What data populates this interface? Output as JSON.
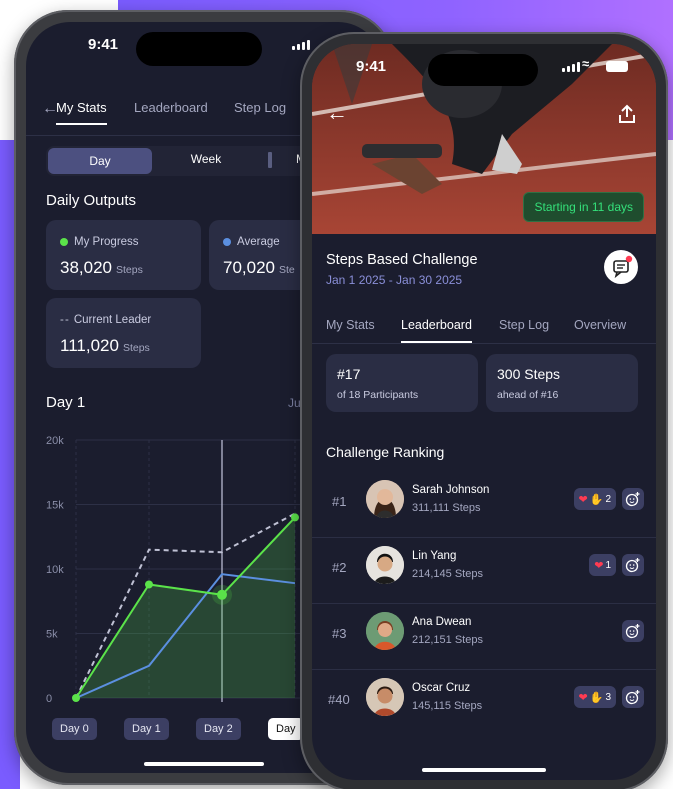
{
  "colors": {
    "accent_green": "#5be34a",
    "accent_blue": "#5b8fe0",
    "leader_grey": "#bfc1d4",
    "bg_dark": "#1b1d2e",
    "card": "#2a2d44"
  },
  "phone1": {
    "status_time": "9:41",
    "tabs": [
      "My Stats",
      "Leaderboard",
      "Step Log"
    ],
    "segments": [
      "Day",
      "Week",
      "M"
    ],
    "section_title": "Daily Outputs",
    "cards": {
      "my_progress": {
        "label": "My Progress",
        "value": "38,020",
        "unit": "Steps"
      },
      "average": {
        "label": "Average",
        "value": "70,020",
        "unit": "Ste"
      },
      "current_leader": {
        "label": "Current Leader",
        "value": "111,020",
        "unit": "Steps"
      }
    },
    "chart_title": "Day 1",
    "chart_title_right": "Ju",
    "x_buttons": [
      "Day 0",
      "Day 1",
      "Day 2",
      "Day"
    ]
  },
  "chart_data": {
    "type": "line",
    "x": [
      0,
      1,
      2,
      3
    ],
    "ylim": [
      0,
      20000
    ],
    "y_ticks": [
      "0",
      "5k",
      "10k",
      "15k",
      "20k"
    ],
    "series": [
      {
        "name": "My Progress",
        "values": [
          0,
          8800,
          8000,
          14000
        ]
      },
      {
        "name": "Average",
        "values": [
          0,
          2500,
          9600,
          8900
        ]
      },
      {
        "name": "Current Leader",
        "values": [
          0,
          11500,
          11300,
          14300
        ]
      }
    ],
    "grid": true
  },
  "phone2": {
    "status_time": "9:41",
    "hero_badge": "Starting in 11 days",
    "challenge_title": "Steps Based Challenge",
    "challenge_dates": "Jan 1 2025 - Jan 30 2025",
    "tabs": [
      "My Stats",
      "Leaderboard",
      "Step Log",
      "Overview"
    ],
    "stat_cards": [
      {
        "value": "#17",
        "sub": "of 18 Participants"
      },
      {
        "value": "300 Steps",
        "sub": "ahead of #16"
      }
    ],
    "ranking_title": "Challenge Ranking",
    "ranking": [
      {
        "rank": "#1",
        "name": "Sarah Johnson",
        "steps": "311,111 Steps",
        "reaction_count": "2"
      },
      {
        "rank": "#2",
        "name": "Lin Yang",
        "steps": "214,145 Steps",
        "reaction_count": "1"
      },
      {
        "rank": "#3",
        "name": "Ana Dwean",
        "steps": "212,151 Steps",
        "reaction_count": ""
      },
      {
        "rank": "#40",
        "name": "Oscar Cruz",
        "steps": "145,115 Steps",
        "reaction_count": "3"
      }
    ]
  }
}
